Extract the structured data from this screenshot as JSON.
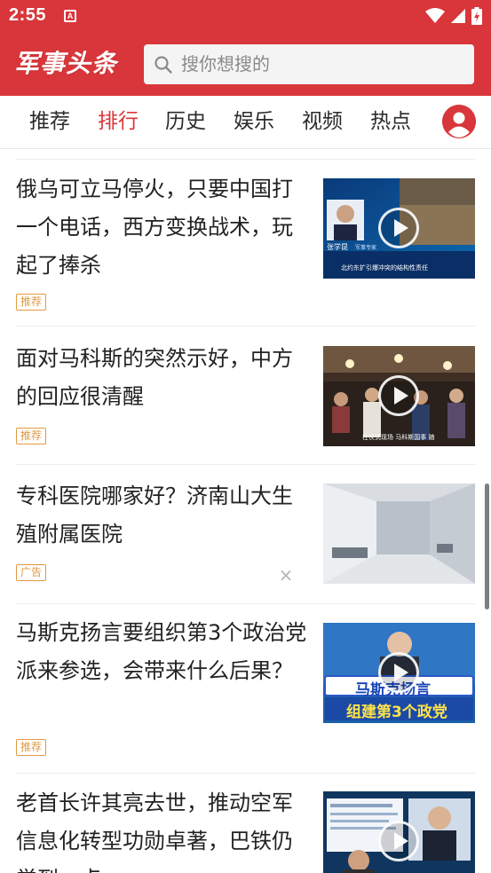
{
  "status_bar": {
    "time": "2:55",
    "notification_letter": "A"
  },
  "header": {
    "logo_text": "军事头条",
    "search": {
      "placeholder": "搜你想搜的"
    }
  },
  "tabs": [
    {
      "label": "推荐",
      "active": false
    },
    {
      "label": "排行",
      "active": true
    },
    {
      "label": "历史",
      "active": false
    },
    {
      "label": "娱乐",
      "active": false
    },
    {
      "label": "视频",
      "active": false
    },
    {
      "label": "热点",
      "active": false
    }
  ],
  "articles": [
    {
      "title": "俄乌可立马停火，只要中国打一个电话，西方变换战术，玩起了捧杀",
      "badge": "推荐",
      "thumb_caption": "北约东扩引爆冲突的结构性责任",
      "thumb_name": "张学昆",
      "thumb_name_suffix": "军事专家",
      "video": true
    },
    {
      "title": "面对马科斯的突然示好，中方的回应很清醒",
      "badge": "推荐",
      "thumb_caption": "在仪式现场 马科斯国事 随 ",
      "video": true
    },
    {
      "title": "专科医院哪家好？济南山大生殖附属医院",
      "badge": "广告",
      "close_glyph": "×",
      "video": false
    },
    {
      "title": "马斯克扬言要组织第3个政治党派来参选，会带来什么后果？",
      "badge": "推荐",
      "thumb_headline_1": "马斯克扬言",
      "thumb_headline_2": "组建第3个政党",
      "video": true
    },
    {
      "title": "老首长许其亮去世，推动空军信息化转型功勋卓著，巴铁仍觉到一点",
      "badge": "",
      "video": true
    }
  ],
  "colors": {
    "brand_red": "#d8363a",
    "badge_orange": "#e09a43"
  }
}
